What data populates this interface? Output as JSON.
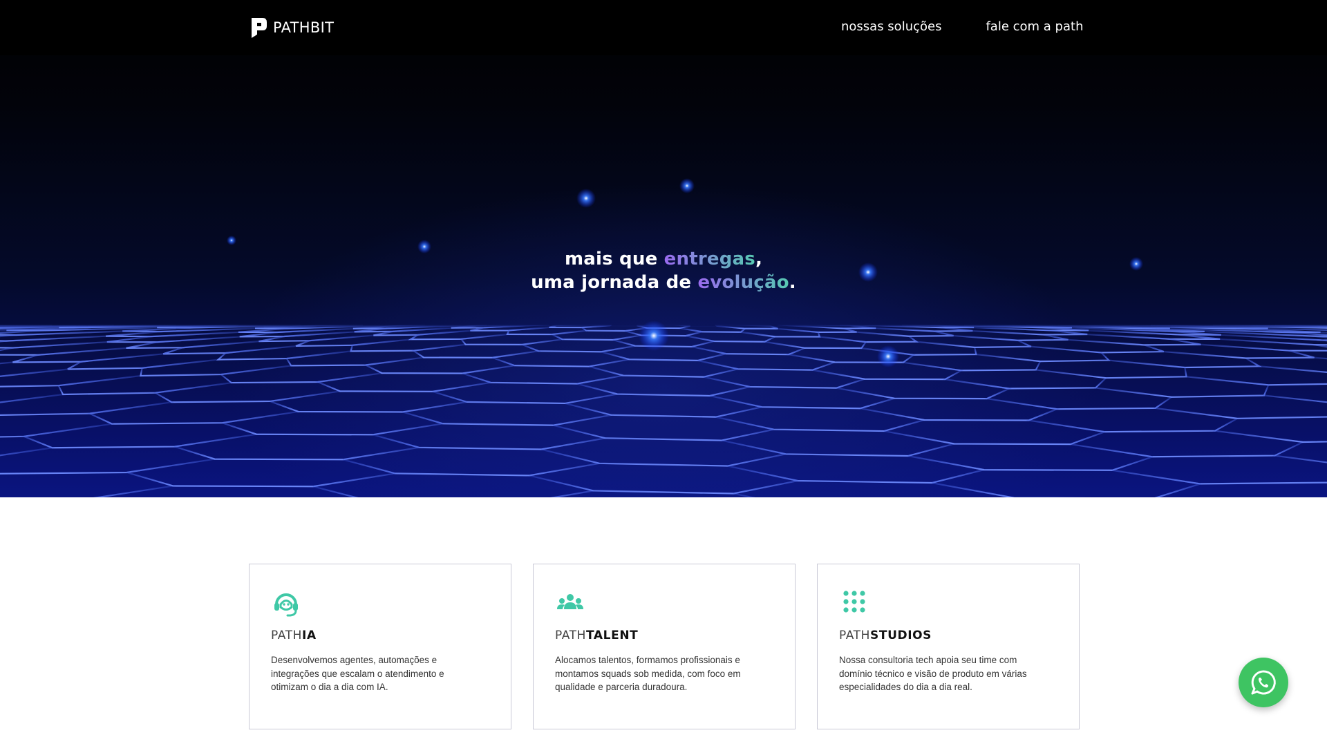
{
  "header": {
    "logo_text": "PATHBIT",
    "nav": [
      {
        "label": "nossas soluções"
      },
      {
        "label": "fale com a path"
      }
    ]
  },
  "hero": {
    "line1_pre": "mais que ",
    "line1_highlight": "entregas",
    "line1_post": ",",
    "line2_pre": "uma jornada de ",
    "line2_highlight": "evolução",
    "line2_post": "."
  },
  "cards": [
    {
      "icon": "headset-agent-icon",
      "title_prefix": "PATH",
      "title_suffix": "IA",
      "description": "Desenvolvemos agentes, automações e integrações que escalam o atendimento e otimizam o dia a dia com IA."
    },
    {
      "icon": "team-users-icon",
      "title_prefix": "PATH",
      "title_suffix": "TALENT",
      "description": "Alocamos talentos, formamos profissionais e montamos squads sob medida, com foco em qualidade e parceria duradoura."
    },
    {
      "icon": "dot-grid-icon",
      "title_prefix": "PATH",
      "title_suffix": "STUDIOS",
      "description": "Nossa consultoria tech apoia seu time com domínio técnico e visão de produto em várias especialidades do dia a dia real."
    }
  ],
  "floating": {
    "icon": "whatsapp-icon"
  },
  "colors": {
    "accent_teal": "#3fc8a6",
    "accent_purple": "#8f6ee8",
    "whatsapp_green": "#3ec462",
    "header_bg": "#000000"
  }
}
